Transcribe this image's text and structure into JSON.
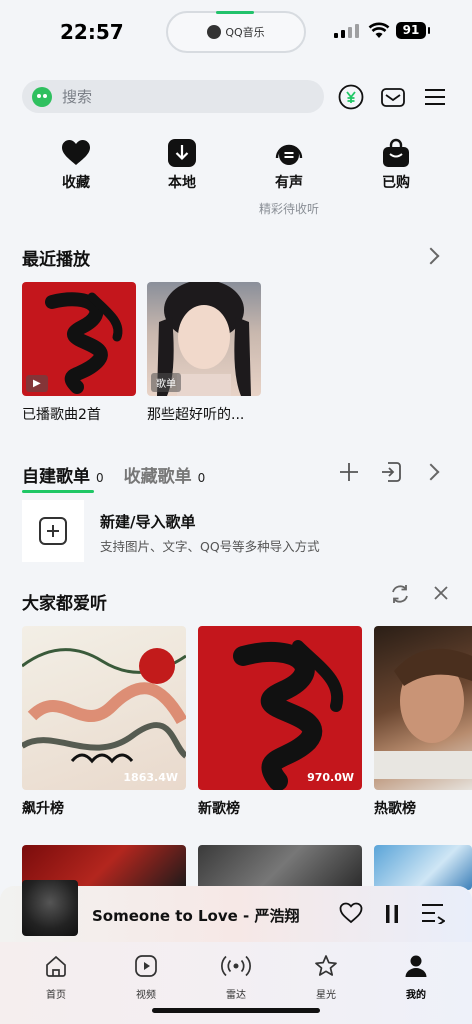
{
  "status_bar": {
    "time": "22:57",
    "island_label": "QQ音乐",
    "battery": "91"
  },
  "search": {
    "placeholder": "搜索"
  },
  "quick_actions": [
    {
      "label": "收藏",
      "icon": "heart-icon"
    },
    {
      "label": "本地",
      "icon": "download-icon"
    },
    {
      "label": "有声",
      "icon": "headphones-icon",
      "sub": "精彩待收听"
    },
    {
      "label": "已购",
      "icon": "shopping-bag-icon"
    }
  ],
  "recent": {
    "title": "最近播放",
    "items": [
      {
        "caption": "已播歌曲2首"
      },
      {
        "caption": "那些超好听的...",
        "badge": "歌单"
      }
    ]
  },
  "playlists": {
    "tab_created": "自建歌单",
    "created_count": "0",
    "tab_favorited": "收藏歌单",
    "favorited_count": "0",
    "new_title": "新建/导入歌单",
    "new_sub": "支持图片、文字、QQ号等多种导入方式"
  },
  "everyone": {
    "title": "大家都爱听",
    "cards": [
      {
        "caption": "飙升榜",
        "plays": "1863.4W"
      },
      {
        "caption": "新歌榜",
        "plays": "970.0W"
      },
      {
        "caption": "热歌榜"
      }
    ]
  },
  "player": {
    "song": "Someone to Love - 严浩翔"
  },
  "tabbar": [
    {
      "label": "首页"
    },
    {
      "label": "视频"
    },
    {
      "label": "雷达"
    },
    {
      "label": "星光"
    },
    {
      "label": "我的"
    }
  ],
  "colors": {
    "accent": "#1fc765",
    "red_cover": "#c4161c"
  }
}
